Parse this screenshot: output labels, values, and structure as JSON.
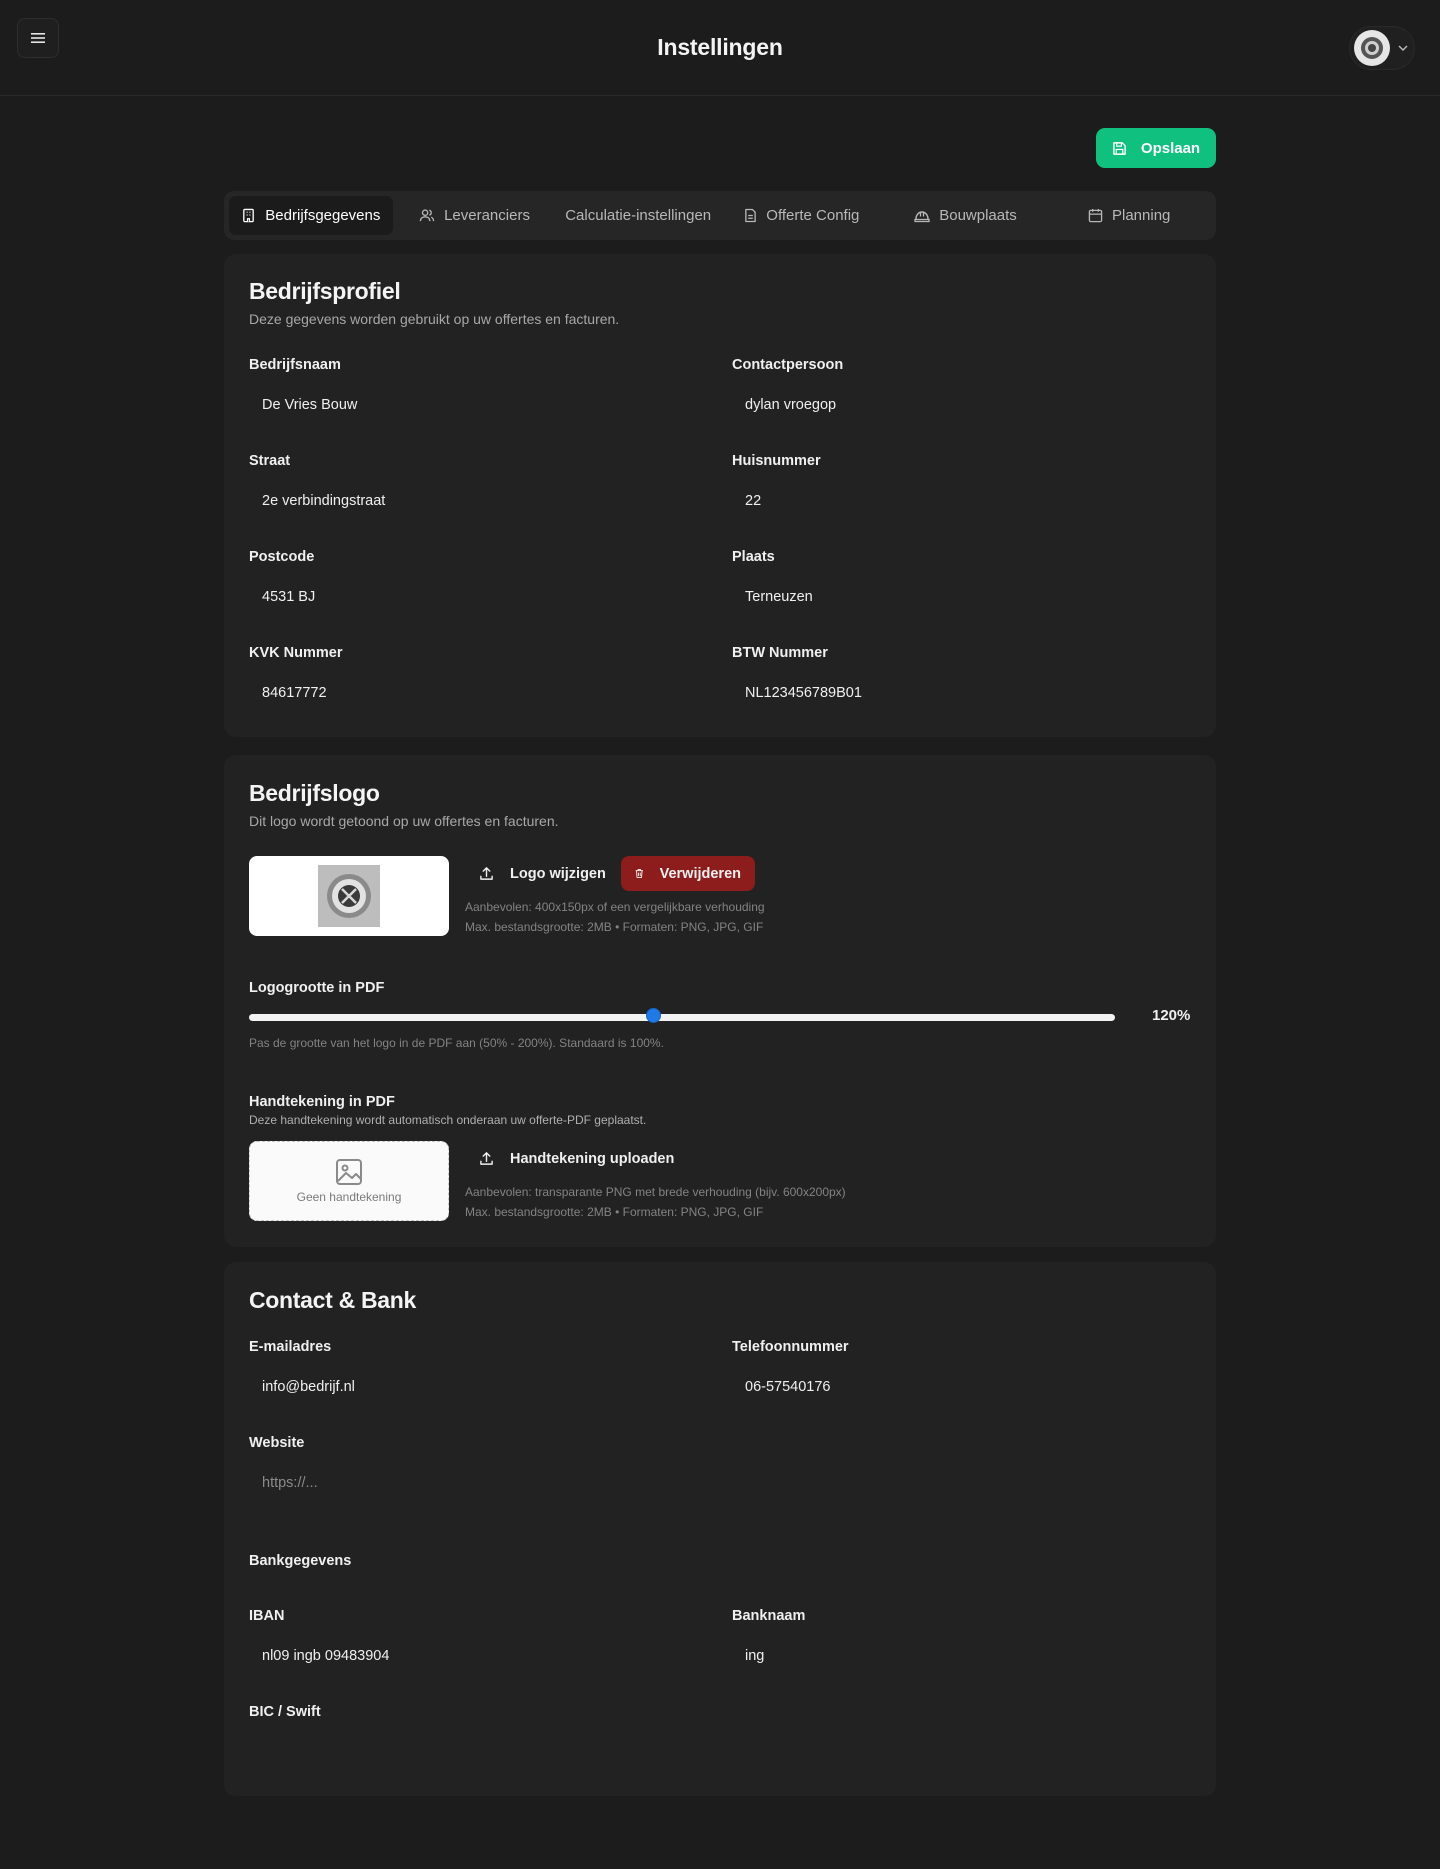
{
  "header": {
    "title": "Instellingen"
  },
  "toolbar": {
    "save_label": "Opslaan"
  },
  "tabs": [
    {
      "label": "Bedrijfsgegevens",
      "icon": "building-icon",
      "active": true
    },
    {
      "label": "Leveranciers",
      "icon": "users-icon"
    },
    {
      "label": "Calculatie-instellingen"
    },
    {
      "label": "Offerte Config",
      "icon": "document-icon"
    },
    {
      "label": "Bouwplaats",
      "icon": "hardhat-icon"
    },
    {
      "label": "Planning",
      "icon": "calendar-icon"
    }
  ],
  "profile": {
    "title": "Bedrijfsprofiel",
    "subtitle": "Deze gegevens worden gebruikt op uw offertes en facturen.",
    "fields": {
      "company_name": {
        "label": "Bedrijfsnaam",
        "value": "De Vries Bouw"
      },
      "contact": {
        "label": "Contactpersoon",
        "value": "dylan vroegop"
      },
      "street": {
        "label": "Straat",
        "value": "2e verbindingstraat"
      },
      "house_number": {
        "label": "Huisnummer",
        "value": "22"
      },
      "postcode": {
        "label": "Postcode",
        "value": "4531 BJ"
      },
      "city": {
        "label": "Plaats",
        "value": "Terneuzen"
      },
      "kvk": {
        "label": "KVK Nummer",
        "value": "84617772"
      },
      "btw": {
        "label": "BTW Nummer",
        "value": "NL123456789B01"
      }
    }
  },
  "logo": {
    "title": "Bedrijfslogo",
    "subtitle": "Dit logo wordt getoond op uw offertes en facturen.",
    "change_label": "Logo wijzigen",
    "delete_label": "Verwijderen",
    "hint_recommended": "Aanbevolen: 400x150px of een vergelijkbare verhouding",
    "hint_max": "Max. bestandsgrootte: 2MB • Formaten: PNG, JPG, GIF",
    "size_label": "Logogrootte in PDF",
    "size_value": "120%",
    "size_fraction": 0.4667,
    "size_hint": "Pas de grootte van het logo in de PDF aan (50% - 200%). Standaard is 100%.",
    "signature_title": "Handtekening in PDF",
    "signature_sub": "Deze handtekening wordt automatisch onderaan uw offerte-PDF geplaatst.",
    "signature_empty": "Geen handtekening",
    "signature_upload_label": "Handtekening uploaden",
    "signature_hint_recommended": "Aanbevolen: transparante PNG met brede verhouding (bijv. 600x200px)",
    "signature_hint_max": "Max. bestandsgrootte: 2MB • Formaten: PNG, JPG, GIF"
  },
  "contact": {
    "title": "Contact & Bank",
    "email": {
      "label": "E-mailadres",
      "value": "info@bedrijf.nl"
    },
    "phone": {
      "label": "Telefoonnummer",
      "value": "06-57540176"
    },
    "website": {
      "label": "Website",
      "value": "",
      "placeholder": "https://..."
    },
    "bank_section": "Bankgegevens",
    "iban": {
      "label": "IBAN",
      "value": "nl09 ingb 09483904"
    },
    "bank_name": {
      "label": "Banknaam",
      "value": "ing"
    },
    "bic": {
      "label": "BIC / Swift",
      "value": ""
    }
  },
  "colors": {
    "accent": "#10c07e",
    "danger": "#8d1c1c",
    "slider": "#1f7ae8"
  }
}
